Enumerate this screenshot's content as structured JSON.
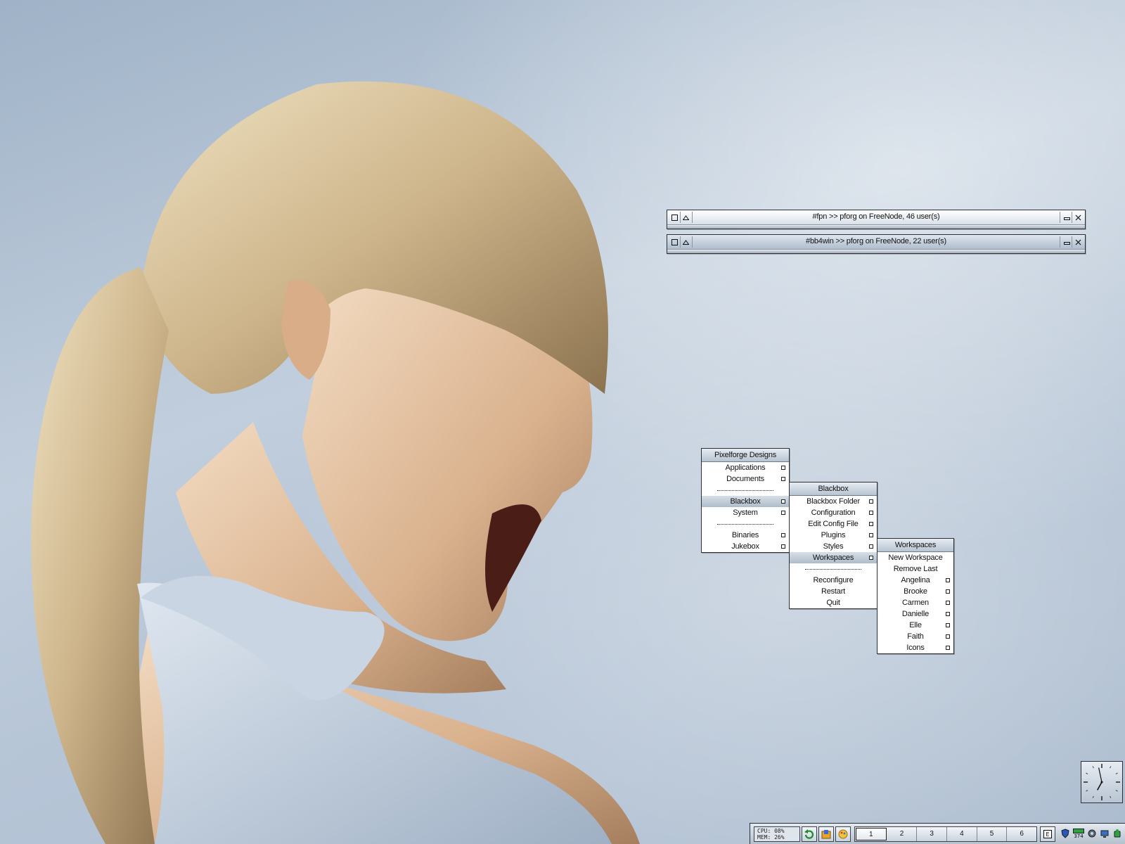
{
  "irc_windows": [
    {
      "title": "#fpn >> pforg on FreeNode, 46 user(s)",
      "active": false
    },
    {
      "title": "#bb4win >> pforg on FreeNode, 22 user(s)",
      "active": true
    }
  ],
  "window_buttons": {
    "menu_icon": "window-menu-icon",
    "shade_icon": "shade-icon",
    "minimize_icon": "minimize-icon",
    "close_icon": "close-icon"
  },
  "menus": {
    "main": {
      "title": "Pixelforge Designs",
      "items": [
        {
          "label": "Applications",
          "submenu": true
        },
        {
          "label": "Documents",
          "submenu": true
        },
        {
          "separator": true
        },
        {
          "label": "Blackbox",
          "submenu": true,
          "selected": true
        },
        {
          "label": "System",
          "submenu": true
        },
        {
          "separator": true
        },
        {
          "label": "Binaries",
          "submenu": true
        },
        {
          "label": "Jukebox",
          "submenu": true
        }
      ]
    },
    "blackbox": {
      "title": "Blackbox",
      "items": [
        {
          "label": "Blackbox Folder",
          "submenu": true
        },
        {
          "label": "Configuration",
          "submenu": true
        },
        {
          "label": "Edit Config File",
          "submenu": true
        },
        {
          "label": "Plugins",
          "submenu": true
        },
        {
          "label": "Styles",
          "submenu": true
        },
        {
          "label": "Workspaces",
          "submenu": true,
          "selected": true
        },
        {
          "separator": true
        },
        {
          "label": "Reconfigure"
        },
        {
          "label": "Restart"
        },
        {
          "label": "Quit"
        }
      ]
    },
    "workspaces": {
      "title": "Workspaces",
      "items": [
        {
          "label": "New Workspace"
        },
        {
          "label": "Remove Last"
        },
        {
          "label": "Angelina",
          "submenu": true
        },
        {
          "label": "Brooke",
          "submenu": true
        },
        {
          "label": "Carmen",
          "submenu": true
        },
        {
          "label": "Danielle",
          "submenu": true
        },
        {
          "label": "Elle",
          "submenu": true
        },
        {
          "label": "Faith",
          "submenu": true
        },
        {
          "label": "Icons",
          "submenu": true
        }
      ]
    }
  },
  "toolbar": {
    "cpu_label": "CPU:",
    "cpu_value": "08%",
    "mem_label": "MEM:",
    "mem_value": "26%",
    "workspaces": [
      "1",
      "2",
      "3",
      "4",
      "5",
      "6"
    ],
    "current_workspace": "1",
    "tray_number": "374",
    "launchers": [
      "refresh-icon",
      "folder-icon",
      "palette-icon"
    ]
  },
  "clock": {
    "hour": 6,
    "minute": 58
  },
  "colors": {
    "menu_title": "#b7c4d2",
    "selected": "#aebcca",
    "border": "#2b2f36"
  }
}
